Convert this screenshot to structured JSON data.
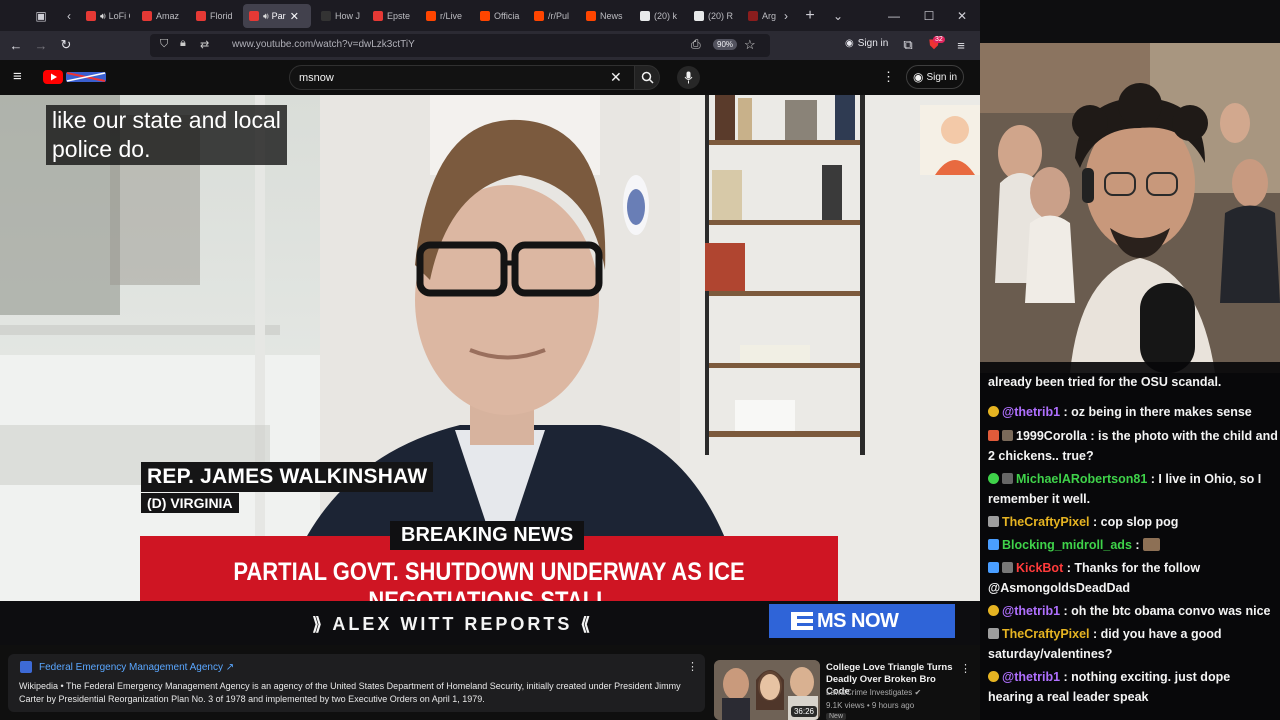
{
  "browser": {
    "tabs": [
      {
        "label": "LoFi C",
        "color": "#e53935",
        "sound": true
      },
      {
        "label": "Amaz",
        "color": "#e53935",
        "sound": false
      },
      {
        "label": "Florid",
        "color": "#e53935",
        "sound": false
      },
      {
        "label": "Par",
        "color": "#e53935",
        "sound": true,
        "active": true
      },
      {
        "label": "How J",
        "color": "#333333",
        "sound": false
      },
      {
        "label": "Epste",
        "color": "#e53935",
        "sound": false
      },
      {
        "label": "r/Live",
        "color": "#ff4500",
        "sound": false
      },
      {
        "label": "Officia",
        "color": "#ff4500",
        "sound": false
      },
      {
        "label": "/r/Pul",
        "color": "#ff4500",
        "sound": false
      },
      {
        "label": "News",
        "color": "#ff4500",
        "sound": false
      },
      {
        "label": "(20) k",
        "color": "#e7e9ea",
        "sound": false
      },
      {
        "label": "(20) R",
        "color": "#e7e9ea",
        "sound": false
      },
      {
        "label": "Arg",
        "color": "#8b1d1d",
        "sound": false
      }
    ],
    "url": "www.youtube.com/watch?v=dwLzk3ctTiY",
    "zoom": "90%",
    "signin": "Sign in",
    "notif_count": "32",
    "icons": [
      "back-icon",
      "forward-icon",
      "reload-icon",
      "shield-icon",
      "lock-icon",
      "bookmark-star-icon",
      "extensions-icon",
      "menu-icon"
    ]
  },
  "youtube": {
    "search_query": "msnow",
    "signin": "Sign in"
  },
  "video": {
    "caption_lines": [
      "like our state and local",
      "police do."
    ],
    "name": "REP. JAMES WALKINSHAW",
    "party": "(D) VIRGINIA",
    "breaking": "BREAKING NEWS",
    "headline": "PARTIAL GOVT. SHUTDOWN UNDERWAY AS ICE NEGOTIATIONS STALL",
    "show": "⟫ ALEX WITT REPORTS ⟪",
    "network": "MS NOW"
  },
  "info_card": {
    "title": "Federal Emergency Management Agency ↗",
    "source": "Wikipedia",
    "body": " • The Federal Emergency Management Agency is an agency of the United States Department of Homeland Security, initially created under President Jimmy Carter by Presidential Reorganization Plan No. 3 of 1978 and implemented by two Executive Orders on April 1, 1979."
  },
  "recommendation": {
    "title": "College Love Triangle Turns Deadly Over Broken Bro Code",
    "channel": "Law&Crime Investigates ✔",
    "meta": "9.1K views • 9 hours ago",
    "badge": "New",
    "duration": "36:26"
  },
  "chat": [
    {
      "user": "",
      "color": "#ffffff",
      "text": "already been tried for the OSU scandal.",
      "icon": ""
    },
    {
      "user": "@thetrib1",
      "color": "#b070ff",
      "text": " : oz being in there makes sense",
      "icon": "#e6b422"
    },
    {
      "user": "1999Corolla",
      "color": "#f4f4f4",
      "text": " : is the photo with the child and 2 chickens.. true?",
      "icon": "#e05b3a"
    },
    {
      "user": "MichaelARobertson81",
      "color": "#3fd24a",
      "text": " : I live in Ohio, so I remember it well.",
      "icon": "#3fd24a"
    },
    {
      "user": "TheCraftyPixel",
      "color": "#e6b422",
      "text": " : cop slop pog",
      "icon": "#9e9e9e"
    },
    {
      "user": "Blocking_midroll_ads",
      "color": "#3fd24a",
      "text": " : ",
      "icon": "#4a9eff"
    },
    {
      "user": "KickBot",
      "color": "#ff3b3b",
      "text": " : Thanks for the follow @AsmongoldsDeadDad",
      "icon": "#4a9eff"
    },
    {
      "user": "@thetrib1",
      "color": "#b070ff",
      "text": " : oh the btc obama convo was nice",
      "icon": "#e6b422"
    },
    {
      "user": "TheCraftyPixel",
      "color": "#e6b422",
      "text": " : did you have a good saturday/valentines?",
      "icon": "#9e9e9e"
    },
    {
      "user": "@thetrib1",
      "color": "#b070ff",
      "text": " : nothing exciting. just dope hearing a real leader speak",
      "icon": "#e6b422"
    }
  ]
}
